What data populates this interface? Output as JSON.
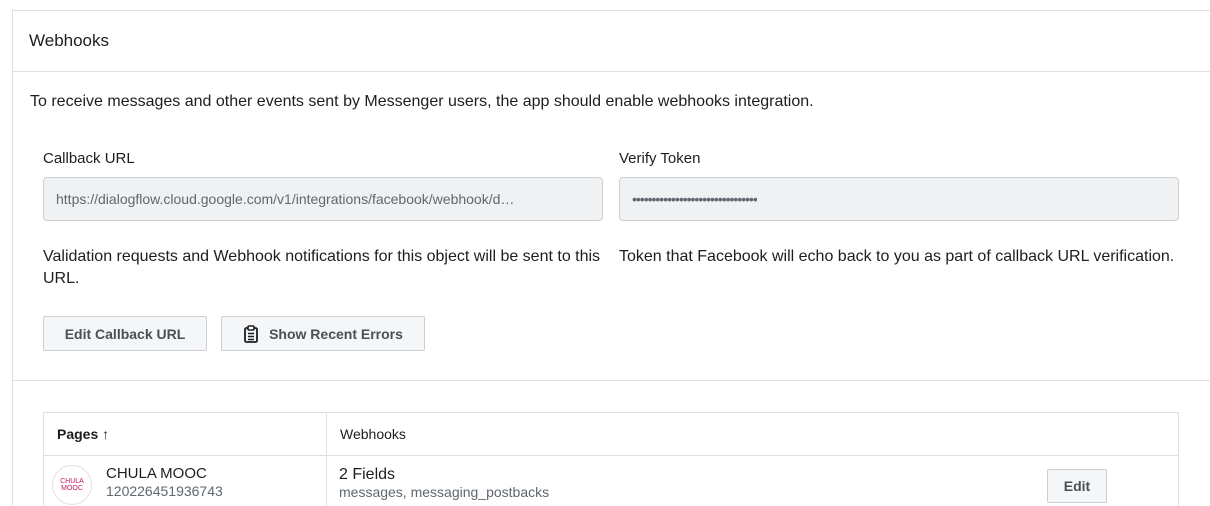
{
  "panel": {
    "title": "Webhooks"
  },
  "intro": "To receive messages and other events sent by Messenger users, the app should enable webhooks integration.",
  "callback": {
    "label": "Callback URL",
    "value": "https://dialogflow.cloud.google.com/v1/integrations/facebook/webhook/d…",
    "help": "Validation requests and Webhook notifications for this object will be sent to this URL."
  },
  "verify": {
    "label": "Verify Token",
    "value": "••••••••••••••••••••••••••••••••",
    "help": "Token that Facebook will echo back to you as part of callback URL verification."
  },
  "buttons": {
    "edit_callback": "Edit Callback URL",
    "show_errors": "Show Recent Errors",
    "show_errors_icon": "clipboard-icon"
  },
  "table": {
    "headers": {
      "pages": "Pages ↑",
      "webhooks": "Webhooks"
    },
    "rows": [
      {
        "avatar_text": "CHULA MOOC",
        "page_name": "CHULA MOOC",
        "page_id": "120226451936743",
        "fields_count": "2 Fields",
        "fields_list": "messages, messaging_postbacks",
        "edit_label": "Edit"
      }
    ]
  }
}
